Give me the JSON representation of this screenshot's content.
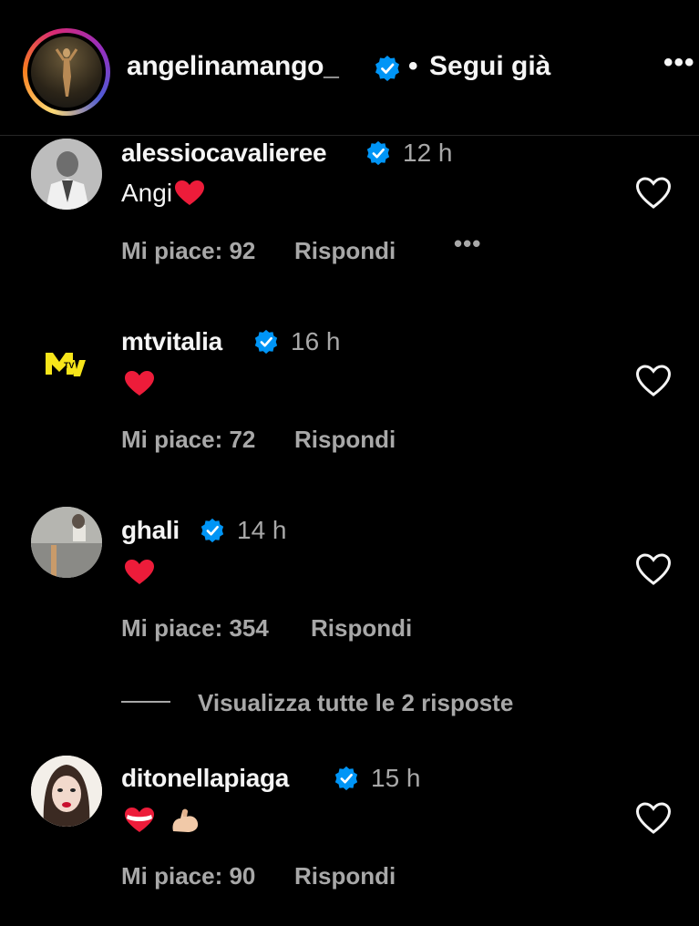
{
  "header": {
    "username": "angelinamango_",
    "separator": "•",
    "follow_label": "Segui già",
    "more_label": "•••",
    "avatar_icon": "story-ring-avatar",
    "verified_icon": "verified-badge-icon"
  },
  "colors": {
    "background": "#000000",
    "primary_text": "#f5f5f5",
    "secondary_text": "#a8a8a8",
    "verified_blue": "#0095f6",
    "heart_red": "#ed1c3a",
    "mtv_yellow": "#f7e51a"
  },
  "comments": [
    {
      "username": "alessiocavalieree",
      "verified": true,
      "time": "12 h",
      "text": "Angi",
      "emojis": [
        "red-heart"
      ],
      "likes": "Mi piace: 92",
      "reply": "Rispondi",
      "more": "•••"
    },
    {
      "username": "mtvitalia",
      "verified": true,
      "time": "16 h",
      "text": "",
      "emojis": [
        "red-heart"
      ],
      "likes": "Mi piace: 72",
      "reply": "Rispondi"
    },
    {
      "username": "ghali",
      "verified": true,
      "time": "14 h",
      "text": "",
      "emojis": [
        "red-heart"
      ],
      "likes": "Mi piace: 354",
      "reply": "Rispondi",
      "view_replies": "Visualizza tutte le 2 risposte"
    },
    {
      "username": "ditonellapiaga",
      "verified": true,
      "time": "15 h",
      "text": "",
      "emojis": [
        "white-red-heart",
        "flexed-biceps"
      ],
      "likes": "Mi piace: 90",
      "reply": "Rispondi"
    }
  ]
}
